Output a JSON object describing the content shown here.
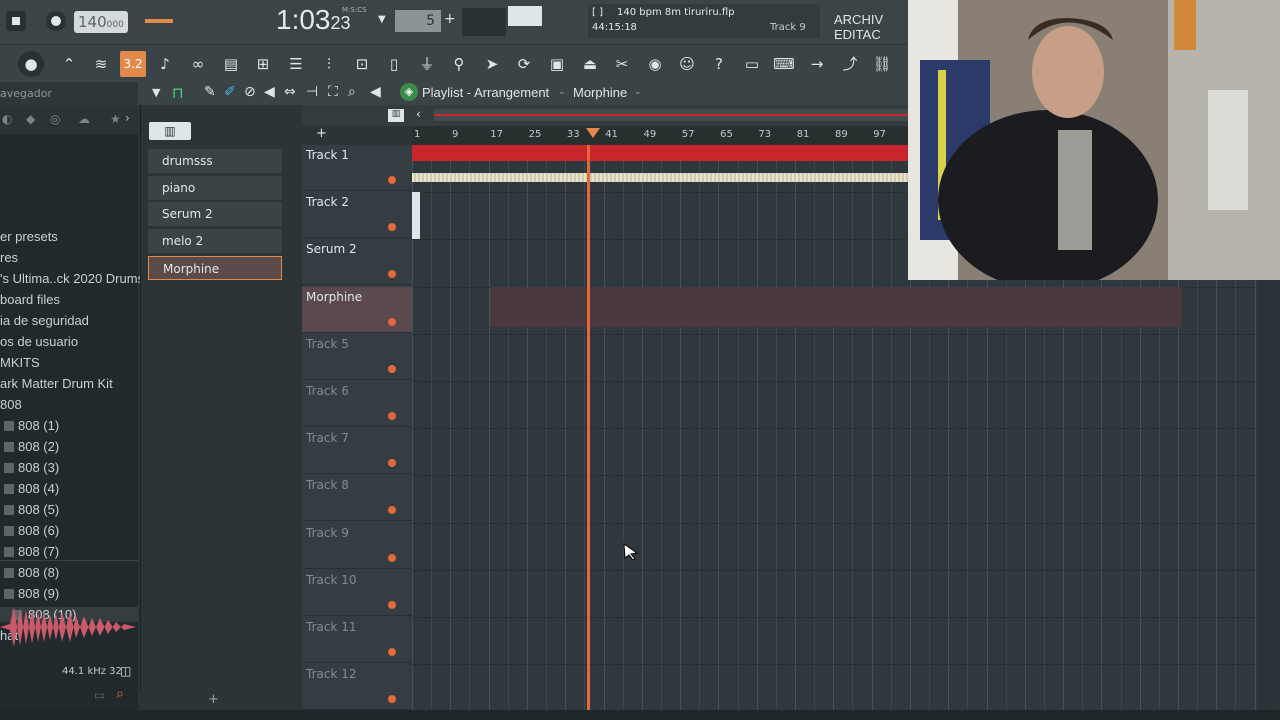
{
  "transport": {
    "tempo": "140",
    "tempo_decimals": "000",
    "time": "1:03",
    "time_sub": "23",
    "time_label": "M:S:CS",
    "pattern_num": "5",
    "project_info": "140 bpm 8m tiruriru.flp",
    "project_time": "44:15:18",
    "track_focus": "Track 9",
    "menu_text": "ARCHIV EDITAC"
  },
  "playlist": {
    "title": "Playlist - Arrangement",
    "pattern_name": "Morphine",
    "ruler_marks": [
      "1",
      "9",
      "17",
      "25",
      "33",
      "41",
      "49",
      "57",
      "65",
      "73",
      "81",
      "89",
      "97"
    ]
  },
  "browser": {
    "items": [
      {
        "label": "er presets",
        "folder": false
      },
      {
        "label": "res",
        "folder": false
      },
      {
        "label": "'s Ultima..ck 2020 Drums",
        "folder": false
      },
      {
        "label": "board files",
        "folder": false
      },
      {
        "label": "ia de seguridad",
        "folder": false
      },
      {
        "label": "os de usuario",
        "folder": false
      },
      {
        "label": "MKITS",
        "folder": false
      },
      {
        "label": "ark Matter Drum Kit",
        "folder": false
      },
      {
        "label": "808",
        "folder": false
      },
      {
        "label": "808 (1)",
        "folder": true
      },
      {
        "label": "808 (2)",
        "folder": true
      },
      {
        "label": "808 (3)",
        "folder": true
      },
      {
        "label": "808 (4)",
        "folder": true
      },
      {
        "label": "808 (5)",
        "folder": true
      },
      {
        "label": "808 (6)",
        "folder": true
      },
      {
        "label": "808 (7)",
        "folder": true
      },
      {
        "label": "808 (8)",
        "folder": true
      },
      {
        "label": "808 (9)",
        "folder": true
      },
      {
        "label": "808 (10)",
        "folder": true
      },
      {
        "label": "hat",
        "folder": false
      }
    ],
    "header": "avegador",
    "sample_info": "44.1 kHz 32"
  },
  "channels": {
    "items": [
      {
        "label": "drumsss"
      },
      {
        "label": "piano"
      },
      {
        "label": "Serum 2"
      },
      {
        "label": "melo 2"
      },
      {
        "label": "Morphine"
      }
    ]
  },
  "tracks": [
    {
      "label": "Track 1"
    },
    {
      "label": "Track 2"
    },
    {
      "label": "Serum 2"
    },
    {
      "label": "Morphine"
    },
    {
      "label": "Track 5"
    },
    {
      "label": "Track 6"
    },
    {
      "label": "Track 7"
    },
    {
      "label": "Track 8"
    },
    {
      "label": "Track 9"
    },
    {
      "label": "Track 10"
    },
    {
      "label": "Track 11"
    },
    {
      "label": "Track 12"
    }
  ],
  "colors": {
    "accent": "#e38a4a",
    "playhead": "#e3683a",
    "clip_red": "#c8262c",
    "clip_selected": "#4a3a40"
  }
}
